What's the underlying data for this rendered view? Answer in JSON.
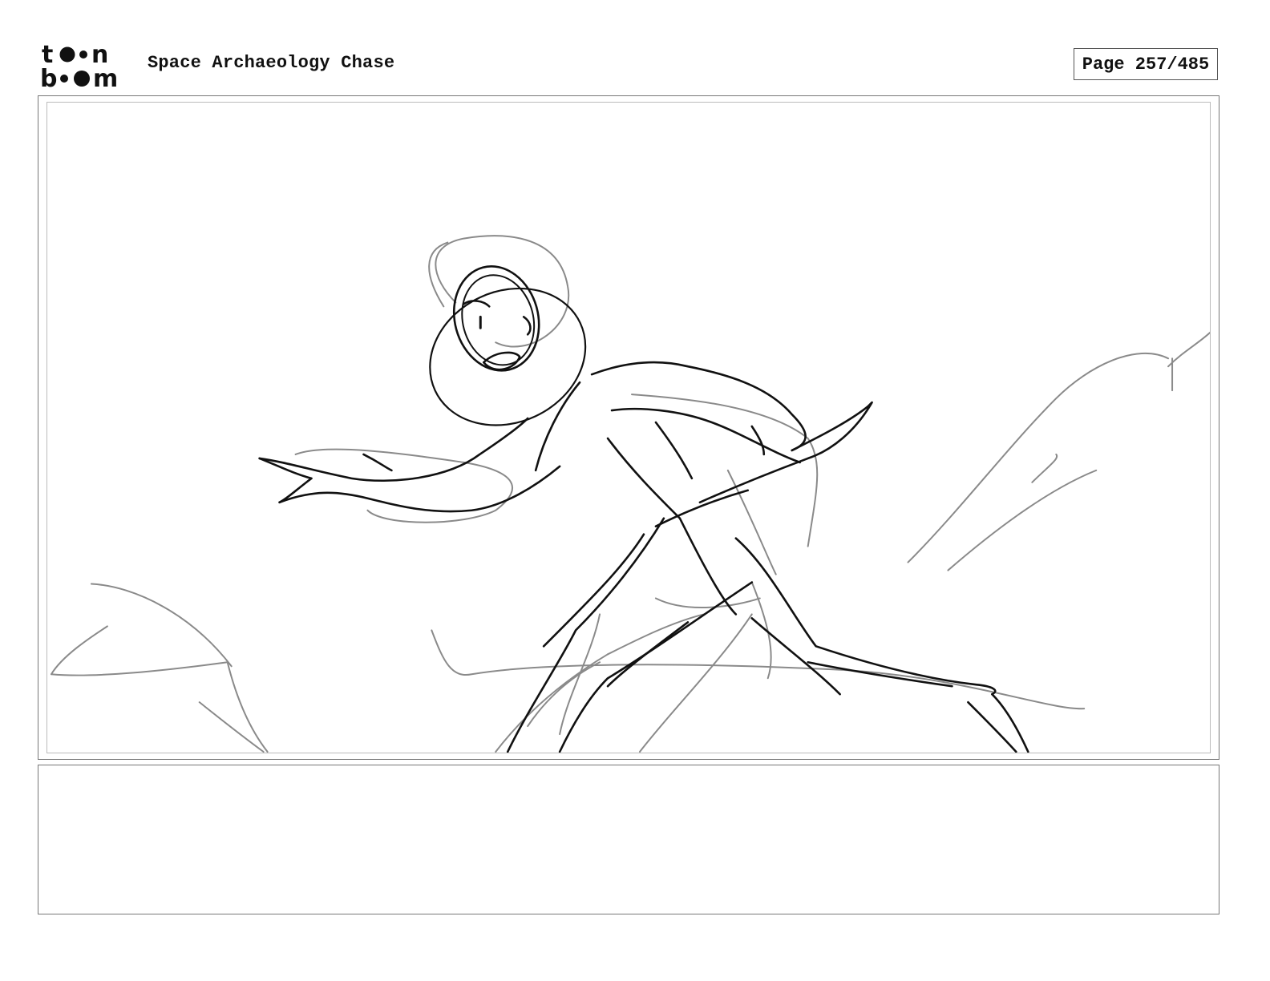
{
  "header": {
    "logo_alt": "toonboom",
    "title": "Space Archaeology Chase",
    "page_label": "Page 257/485"
  },
  "panel": {
    "image_name": "storyboard-sketch-astronaut-running"
  },
  "caption": {
    "text": ""
  },
  "colors": {
    "ink": "#111111",
    "sketch_gray": "#8a8a8a",
    "border": "#777777"
  }
}
